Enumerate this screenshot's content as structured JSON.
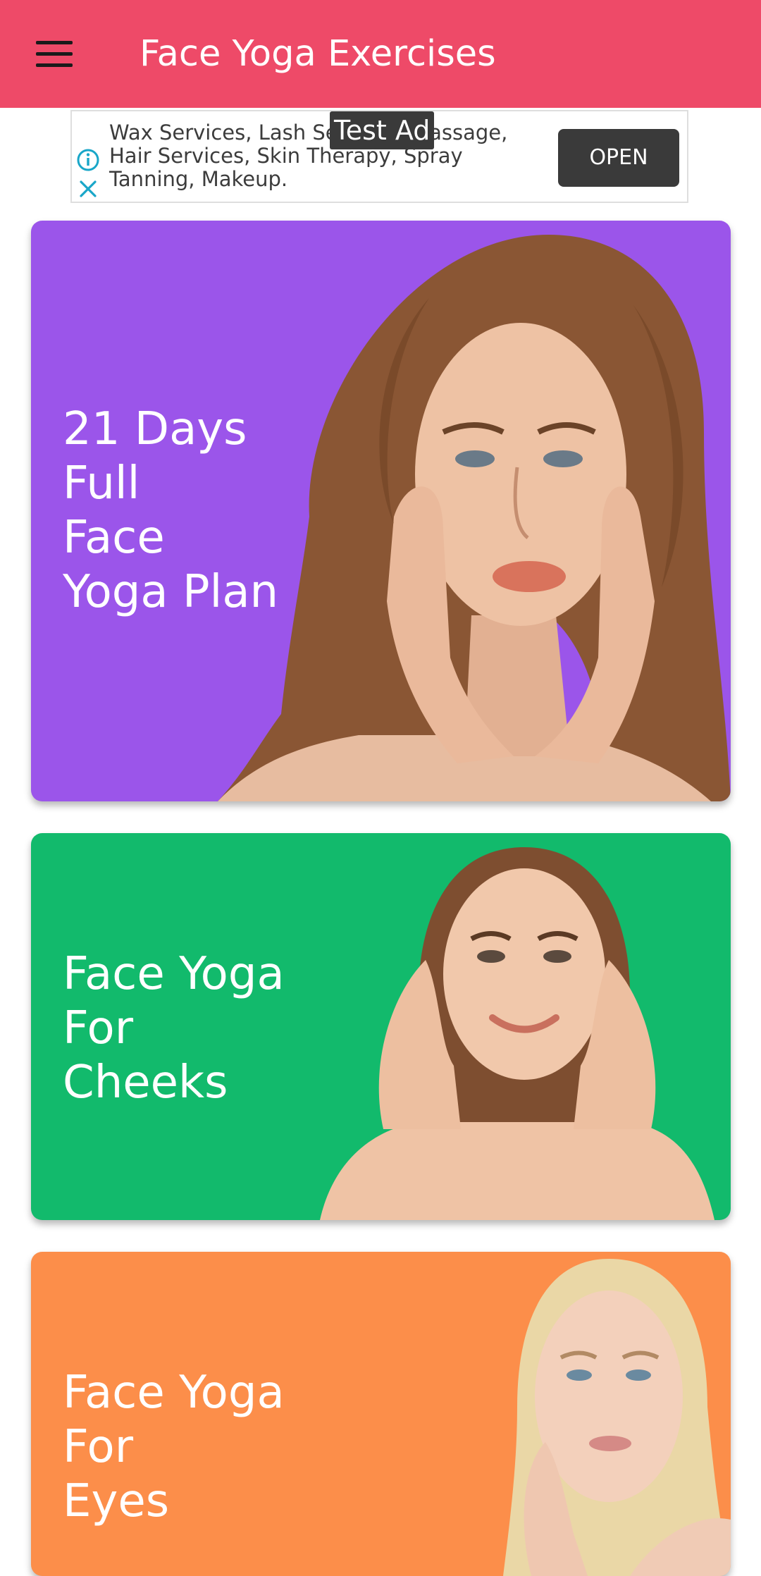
{
  "app_bar": {
    "title": "Face Yoga Exercises",
    "color": "#ee4a68",
    "menu_icon": "hamburger-menu-icon"
  },
  "ad": {
    "label": "Test Ad",
    "text": "Wax Services, Lash Services, Massage, Hair Services, Skin Therapy, Spray Tanning, Makeup.",
    "button": "OPEN",
    "info_icon": "info-icon",
    "close_icon": "close-icon"
  },
  "cards": [
    {
      "lines": [
        "21 Days",
        "Full",
        "Face",
        "Yoga Plan"
      ],
      "color": "#9b55ea"
    },
    {
      "lines": [
        "Face Yoga",
        "For",
        "Cheeks"
      ],
      "color": "#12ba6c"
    },
    {
      "lines": [
        "Face Yoga",
        "For",
        "Eyes"
      ],
      "color": "#fc8e4a"
    }
  ]
}
